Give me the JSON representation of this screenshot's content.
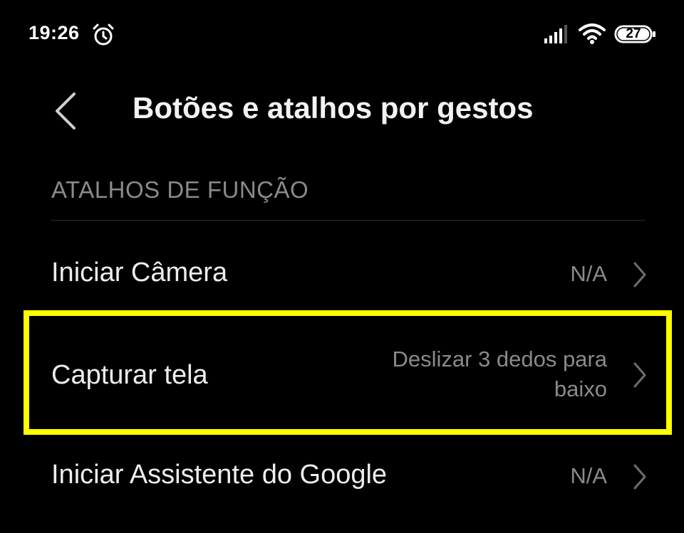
{
  "status_bar": {
    "time": "19:26",
    "battery_level": "27",
    "icons": [
      "alarm-icon",
      "signal-icon",
      "wifi-icon",
      "battery-icon"
    ]
  },
  "header": {
    "title": "Botões e atalhos por gestos",
    "back_icon": "chevron-left-icon"
  },
  "section": {
    "title": "ATALHOS DE FUNÇÃO"
  },
  "items": [
    {
      "label": "Iniciar Câmera",
      "value_lines": [
        "N/A"
      ]
    },
    {
      "label": "Capturar tela",
      "value_lines": [
        "Deslizar 3 dedos para",
        "baixo"
      ],
      "highlighted": true
    },
    {
      "label": "Iniciar Assistente do Google",
      "value_lines": [
        "N/A"
      ]
    }
  ],
  "colors": {
    "background": "#000000",
    "primary_text": "#ededed",
    "secondary_text": "#8a8a8a",
    "highlight": "#ffff00"
  }
}
